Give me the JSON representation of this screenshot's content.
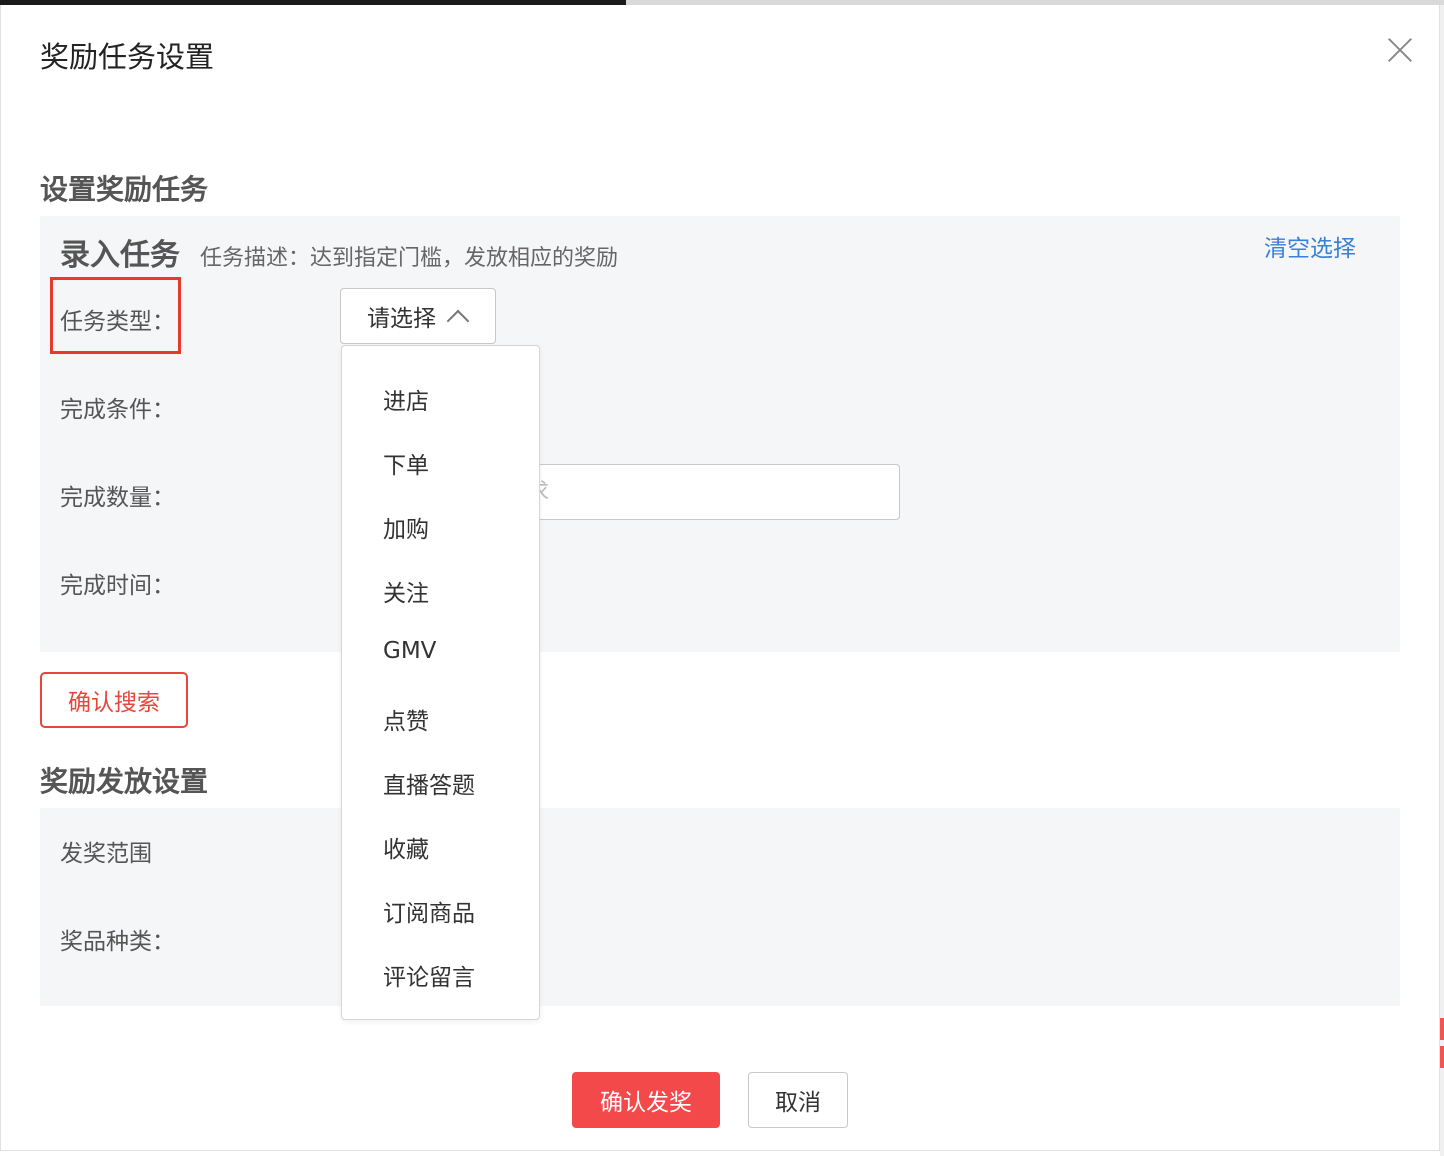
{
  "dialog": {
    "title": "奖励任务设置"
  },
  "task_section": {
    "title": "设置奖励任务",
    "panel_title": "录入任务",
    "description": "任务描述：达到指定门槛，发放相应的奖励",
    "clear_link": "清空选择",
    "fields": {
      "task_type_label": "任务类型：",
      "condition_label": "完成条件：",
      "quantity_label": "完成数量：",
      "time_label": "完成时间："
    },
    "task_type_select": {
      "placeholder": "请选择",
      "options": [
        "进店",
        "下单",
        "加购",
        "关注",
        "GMV",
        "点赞",
        "直播答题",
        "收藏",
        "订阅商品",
        "评论留言"
      ]
    },
    "quantity_input": {
      "placeholder": "求"
    },
    "confirm_search_button": "确认搜索"
  },
  "reward_section": {
    "title": "奖励发放设置",
    "fields": {
      "scope_label": "发奖范围",
      "prize_type_label": "奖品种类："
    }
  },
  "footer": {
    "confirm_button": "确认发奖",
    "cancel_button": "取消"
  },
  "colors": {
    "primary_red": "#f4494b",
    "link_blue": "#3a7fd8",
    "highlight_red": "#e83a2a",
    "panel_bg": "#f5f6f8"
  }
}
